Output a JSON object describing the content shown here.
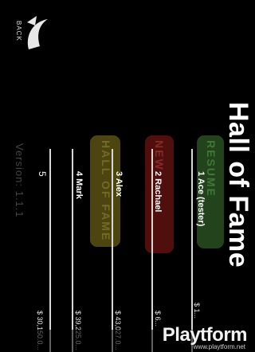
{
  "back": {
    "label": "BACK",
    "icon": "swoosh-arrow-icon"
  },
  "title": "Hall of Fame",
  "menu": {
    "resume": "RESUME",
    "new": "NEW",
    "hall_of_fame": "HALL OF FAME",
    "colors": {
      "resume": "#2e5a25",
      "new": "#6b1412",
      "hall_of_fame": "#6d6318"
    }
  },
  "scores": [
    {
      "rank": "1",
      "name": "Ace (tester)",
      "score": "$ 1..."
    },
    {
      "rank": "2",
      "name": "Rachael",
      "score": "$ 6..."
    },
    {
      "rank": "3",
      "name": "Alex",
      "score": "$ 43,027.0..."
    },
    {
      "rank": "4",
      "name": "Mark",
      "score": "$ 39,225.0..."
    },
    {
      "rank": "5",
      "name": "",
      "score": "$ 30,150.0..."
    }
  ],
  "rank_lines": [
    "1 Ace (tester)",
    "2 Rachael",
    "3 Alex",
    "4 Mark",
    "5"
  ],
  "version": "Version: 1.1.1",
  "watermark": {
    "logo": "Playtform",
    "url": "www.playtform.net"
  }
}
